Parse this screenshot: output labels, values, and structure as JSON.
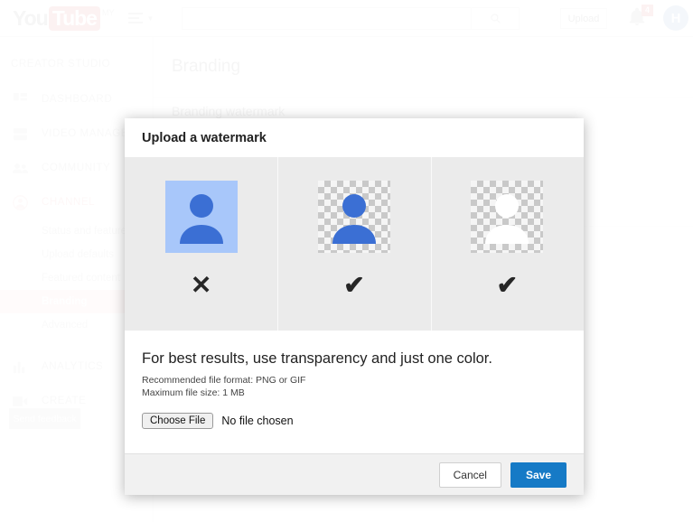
{
  "masthead": {
    "logo_you": "You",
    "logo_tube": "Tube",
    "logo_country": "MY",
    "menu_icon": "hamburger-icon",
    "search_value": "",
    "search_placeholder": "",
    "search_icon": "search-icon",
    "upload_label": "Upload",
    "notifications_icon": "bell-icon",
    "notifications_count": "4",
    "avatar_initial": "H",
    "avatar_color": "#3b78b8",
    "badge_color": "#cc181e"
  },
  "sidebar": {
    "heading": "CREATOR STUDIO",
    "items": [
      {
        "label": "DASHBOARD",
        "icon": "dashboard-icon",
        "active": false
      },
      {
        "label": "VIDEO MANAGER",
        "icon": "video-manager-icon",
        "active": false
      },
      {
        "label": "COMMUNITY",
        "icon": "community-icon",
        "active": false
      },
      {
        "label": "CHANNEL",
        "icon": "channel-icon",
        "active": true
      }
    ],
    "subitems": [
      {
        "label": "Status and features",
        "selected": false
      },
      {
        "label": "Upload defaults",
        "selected": false
      },
      {
        "label": "Featured content",
        "selected": false
      },
      {
        "label": "Branding",
        "selected": true
      },
      {
        "label": "Advanced",
        "selected": false
      }
    ],
    "items_after": [
      {
        "label": "ANALYTICS",
        "icon": "analytics-icon",
        "active": false
      },
      {
        "label": "CREATE",
        "icon": "create-icon",
        "active": false
      }
    ],
    "feedback_label": "Send feedback",
    "selected_color": "#f7c5c5",
    "active_color": "#e7797a"
  },
  "page": {
    "title": "Branding",
    "section_title": "Branding watermark"
  },
  "modal": {
    "title": "Upload a watermark",
    "examples": [
      {
        "name": "solid-background-example",
        "style": "solid",
        "figure_color": "#3b6fd4",
        "background": "#a8c7fa",
        "mark": "✕",
        "mark_meaning": "bad"
      },
      {
        "name": "transparent-color-example",
        "style": "checker",
        "figure_color": "#3b6fd4",
        "background": "checkerboard",
        "mark": "✔",
        "mark_meaning": "good"
      },
      {
        "name": "transparent-white-example",
        "style": "checker",
        "figure_color": "#ffffff",
        "background": "checkerboard",
        "mark": "✔",
        "mark_meaning": "good"
      }
    ],
    "best_results": "For best results, use transparency and just one color.",
    "recommended_format": "Recommended file format: PNG or GIF",
    "max_file_size": "Maximum file size: 1 MB",
    "choose_file_label": "Choose File",
    "no_file_label": "No file chosen",
    "cancel_label": "Cancel",
    "save_label": "Save",
    "save_color": "#167ac6"
  }
}
